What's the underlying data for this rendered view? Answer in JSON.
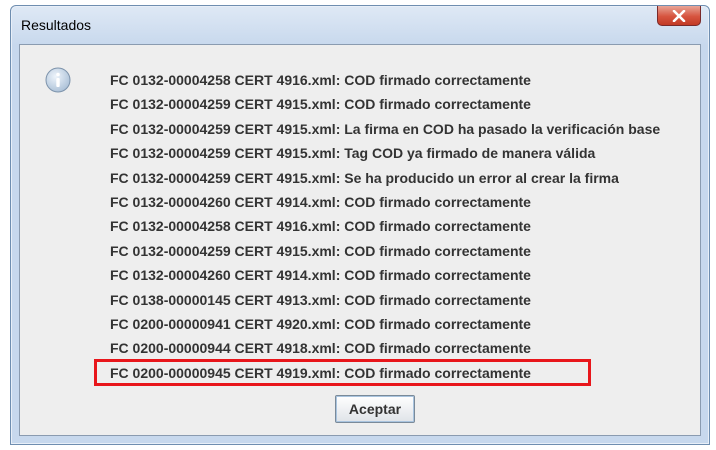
{
  "dialog": {
    "title": "Resultados",
    "icon": "info-icon",
    "close_icon": "close-icon",
    "messages": [
      "FC 0132-00004258 CERT 4916.xml: COD firmado correctamente",
      "FC 0132-00004259 CERT 4915.xml: COD firmado correctamente",
      "FC 0132-00004259 CERT 4915.xml: La firma en COD ha pasado la verificación base",
      "FC 0132-00004259 CERT 4915.xml: Tag COD ya firmado de manera válida",
      "FC 0132-00004259 CERT 4915.xml: Se ha producido un error al crear la firma",
      "FC 0132-00004260 CERT 4914.xml: COD firmado correctamente",
      "FC 0132-00004258 CERT 4916.xml: COD firmado correctamente",
      "FC 0132-00004259 CERT 4915.xml: COD firmado correctamente",
      "FC 0132-00004260 CERT 4914.xml: COD firmado correctamente",
      "FC 0138-00000145 CERT 4913.xml: COD firmado correctamente",
      "FC 0200-00000941 CERT 4920.xml: COD firmado correctamente",
      "FC 0200-00000944 CERT 4918.xml: COD firmado correctamente",
      "FC 0200-00000945 CERT 4919.xml: COD firmado correctamente"
    ],
    "highlighted_index": 12,
    "highlight_color": "#e8161b",
    "accept_label": "Aceptar"
  }
}
